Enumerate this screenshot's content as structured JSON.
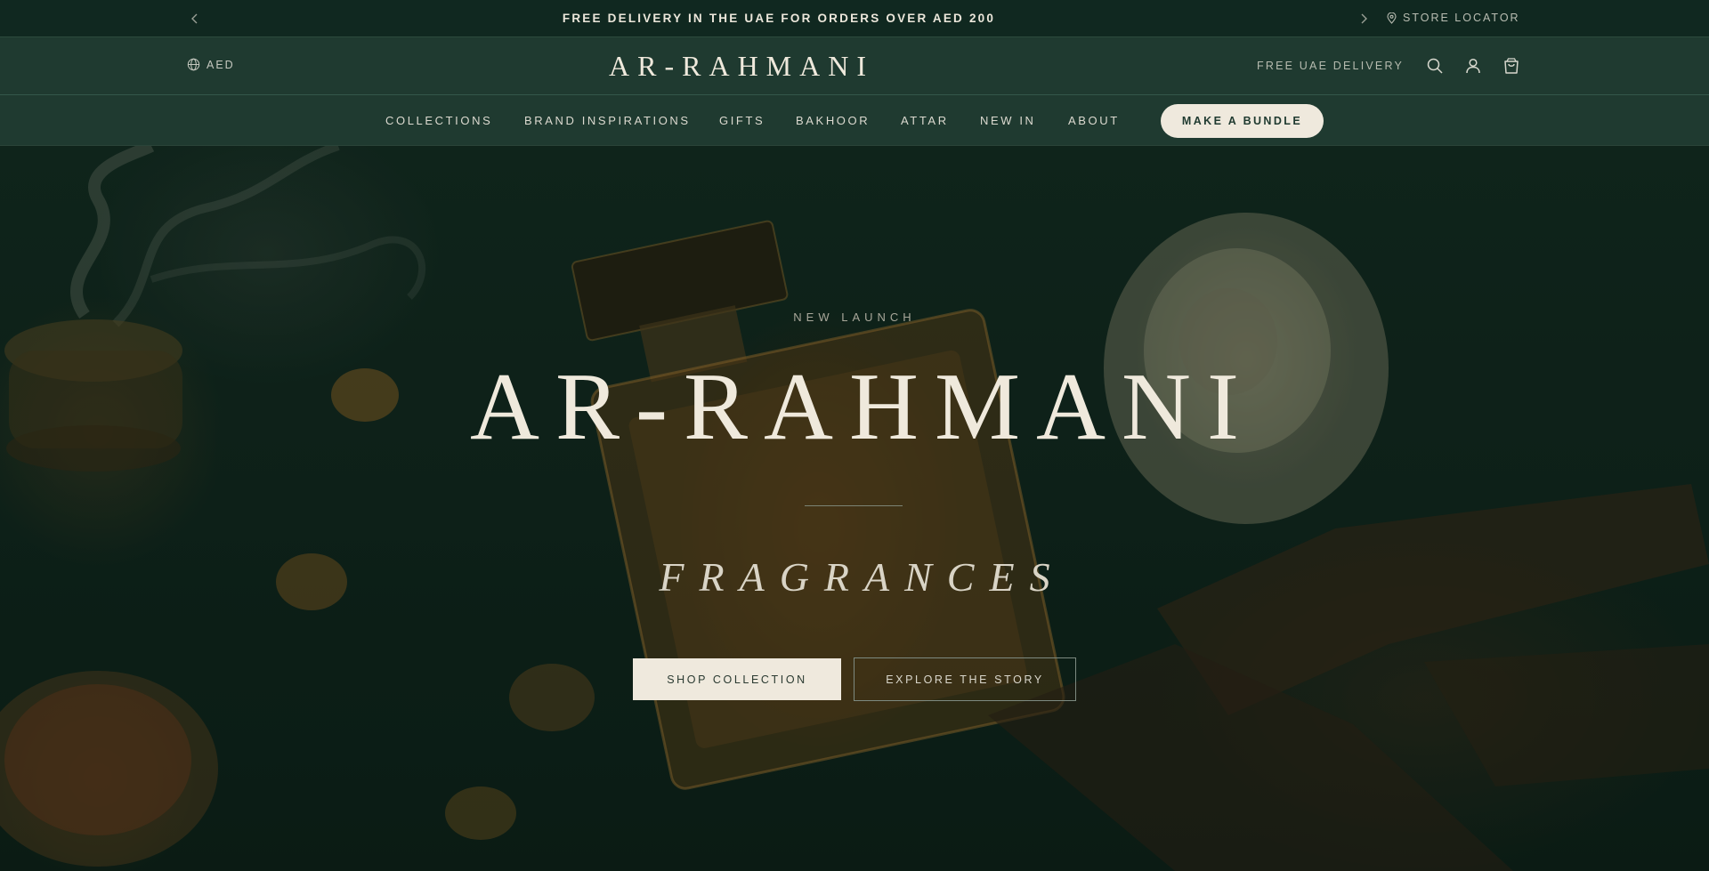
{
  "announcement": {
    "message": "FREE DELIVERY IN THE UAE FOR ORDERS OVER AED 200",
    "store_locator": "STORE LOCATOR",
    "prev_icon": "chevron-left-icon",
    "next_icon": "chevron-right-icon",
    "locator_icon": "map-pin-icon"
  },
  "header": {
    "currency": "AED",
    "currency_icon": "globe-icon",
    "logo": "AR-RAHMANI",
    "delivery_note": "FREE UAE DELIVERY",
    "icons": [
      "search-icon",
      "account-icon",
      "cart-icon"
    ]
  },
  "nav": {
    "items": [
      "COLLECTIONS",
      "BRAND INSPIRATIONS",
      "GIFTS",
      "BAKHOOR",
      "ATTAR",
      "NEW IN",
      "ABOUT"
    ],
    "cta": "MAKE A BUNDLE"
  },
  "hero": {
    "eyebrow": "NEW LAUNCH",
    "title": "AR-RAHMANI",
    "subtitle": "FRAGRANCES",
    "primary_button": "SHOP COLLECTION",
    "secondary_button": "EXPLORE THE STORY"
  },
  "colors": {
    "announcement_bg": "#102820",
    "header_bg": "#1f3a30",
    "cream": "#efe9dd",
    "text_light": "#efe9dc"
  }
}
